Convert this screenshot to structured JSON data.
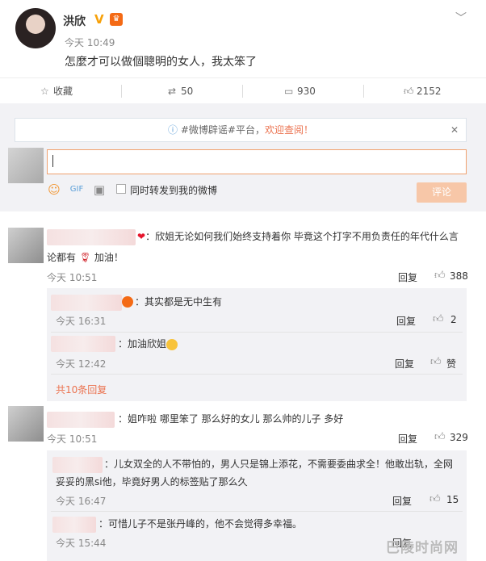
{
  "post": {
    "author": "洪欣",
    "time": "今天 10:49",
    "text": "怎麼才可以做個聰明的女人，我太笨了"
  },
  "actions": {
    "collect": "收藏",
    "repost": "50",
    "comment": "930",
    "like": "2152"
  },
  "notice": {
    "prefix": "#微博辟谣#平台，",
    "accent": "欢迎查阅！"
  },
  "composer": {
    "sync_label": "同时转发到我的微博",
    "submit": "评论"
  },
  "comments": [
    {
      "text": "：欣姐无论如何我们始终支持着你 毕竟这个打字不用负责任的年代什么言",
      "text2a": "论都有",
      "text2b": "加油！",
      "time": "今天 10:51",
      "reply": "回复",
      "likes": "388",
      "subreplies": [
        {
          "text": "：其实都是无中生有",
          "time": "今天 16:31",
          "reply": "回复",
          "likes": "2"
        },
        {
          "text": "：加油欣姐",
          "time": "今天 12:42",
          "reply": "回复",
          "likes": "赞"
        }
      ],
      "more": "共10条回复"
    },
    {
      "text": "：姐咋啦 哪里笨了 那么好的女儿 那么帅的儿子 多好",
      "time": "今天 10:51",
      "reply": "回复",
      "likes": "329",
      "subreplies": [
        {
          "text": "：儿女双全的人不带怕的，男人只是锦上添花，不需要委曲求全！他敢出轨，全网",
          "text2": "妥妥的黑si他，毕竟好男人的标签贴了那么久",
          "time": "今天 16:47",
          "reply": "回复",
          "likes": "15"
        },
        {
          "text": "：可惜儿子不是张丹峰的，他不会觉得多幸福。",
          "time": "今天 15:44",
          "reply": "回复"
        }
      ]
    }
  ],
  "watermark": "巴陵时尚网"
}
